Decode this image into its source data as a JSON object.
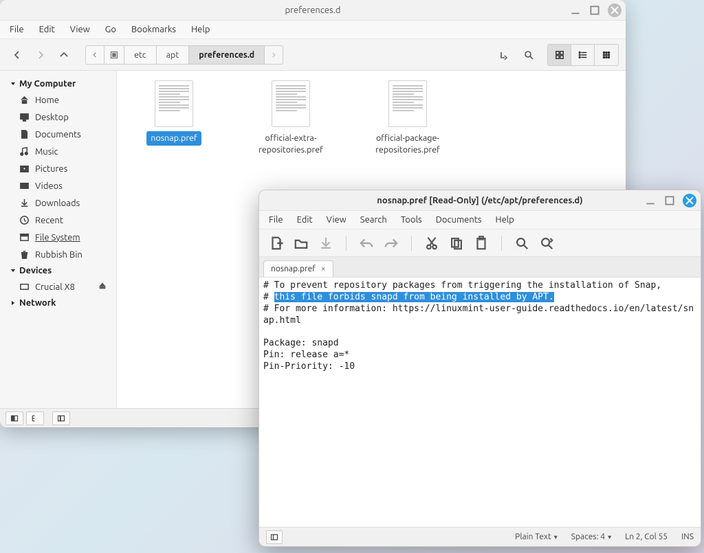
{
  "fm": {
    "title": "preferences.d",
    "menu": [
      "File",
      "Edit",
      "View",
      "Go",
      "Bookmarks",
      "Help"
    ],
    "breadcrumb": [
      "etc",
      "apt",
      "preferences.d"
    ],
    "sidebar_categories": {
      "my_computer": {
        "label": "My Computer",
        "items": [
          {
            "icon": "home-icon",
            "label": "Home"
          },
          {
            "icon": "desktop-icon",
            "label": "Desktop"
          },
          {
            "icon": "documents-icon",
            "label": "Documents"
          },
          {
            "icon": "music-icon",
            "label": "Music"
          },
          {
            "icon": "pictures-icon",
            "label": "Pictures"
          },
          {
            "icon": "videos-icon",
            "label": "Videos"
          },
          {
            "icon": "downloads-icon",
            "label": "Downloads"
          },
          {
            "icon": "recent-icon",
            "label": "Recent"
          },
          {
            "icon": "filesystem-icon",
            "label": "File System",
            "active": true
          },
          {
            "icon": "trash-icon",
            "label": "Rubbish Bin"
          }
        ]
      },
      "devices": {
        "label": "Devices",
        "items": [
          {
            "icon": "drive-icon",
            "label": "Crucial X8",
            "eject": true
          }
        ]
      },
      "network": {
        "label": "Network",
        "collapsed": true
      }
    },
    "files": [
      {
        "name": "nosnap.pref",
        "selected": true
      },
      {
        "name": "official-extra-repositories.pref"
      },
      {
        "name": "official-package-repositories.pref"
      }
    ],
    "status_selection": "\"nosnap.pref\""
  },
  "ed": {
    "title": "nosnap.pref [Read-Only] (/etc/apt/preferences.d)",
    "menu": [
      "File",
      "Edit",
      "View",
      "Search",
      "Tools",
      "Documents",
      "Help"
    ],
    "tab_name": "nosnap.pref",
    "content": {
      "line1": "# To prevent repository packages from triggering the installation of Snap,",
      "line2_prefix": "# ",
      "line2_highlight": "this file forbids snapd from being installed by APT.",
      "line3": "# For more information: https://linuxmint-user-guide.readthedocs.io/en/latest/snap.html",
      "line4": "",
      "line5": "Package: snapd",
      "line6": "Pin: release a=*",
      "line7": "Pin-Priority: -10"
    },
    "status": {
      "syntax": "Plain Text",
      "spaces": "Spaces: 4",
      "pos": "Ln 2, Col 55",
      "mode": "INS"
    }
  }
}
